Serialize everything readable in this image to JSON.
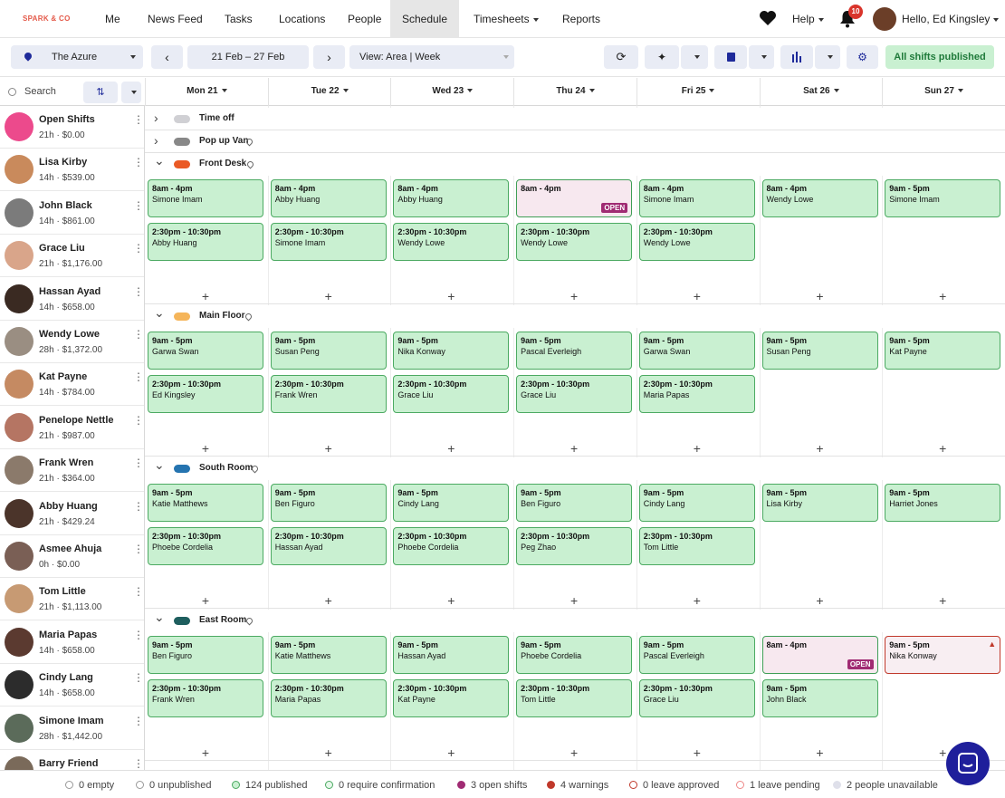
{
  "nav": {
    "logo": "SPARK & CO",
    "items": [
      "Me",
      "News Feed",
      "Tasks",
      "Locations",
      "People",
      "Schedule",
      "Timesheets",
      "Reports"
    ],
    "help": "Help",
    "notif_count": "10",
    "user_greeting": "Hello, Ed Kingsley"
  },
  "toolbar": {
    "location": "The Azure",
    "date_range": "21 Feb – 27 Feb",
    "view": "View: Area | Week",
    "publish_status": "All shifts published",
    "search_placeholder": "Search"
  },
  "days": [
    "Mon 21",
    "Tue 22",
    "Wed 23",
    "Thu 24",
    "Fri 25",
    "Sat 26",
    "Sun 27"
  ],
  "employees": [
    {
      "name": "Open Shifts",
      "stats": "21h · $0.00",
      "color": "#ec4a8c"
    },
    {
      "name": "Lisa Kirby",
      "stats": "14h · $539.00",
      "color": "#c98a5c"
    },
    {
      "name": "John Black",
      "stats": "14h · $861.00",
      "color": "#7b7b7b"
    },
    {
      "name": "Grace Liu",
      "stats": "21h · $1,176.00",
      "color": "#d9a58a"
    },
    {
      "name": "Hassan Ayad",
      "stats": "14h · $658.00",
      "color": "#3a2a22"
    },
    {
      "name": "Wendy Lowe",
      "stats": "28h · $1,372.00",
      "color": "#9a8e82"
    },
    {
      "name": "Kat Payne",
      "stats": "14h · $784.00",
      "color": "#c58a62"
    },
    {
      "name": "Penelope Nettle",
      "stats": "21h · $987.00",
      "color": "#b57563"
    },
    {
      "name": "Frank Wren",
      "stats": "21h · $364.00",
      "color": "#8b7a6b"
    },
    {
      "name": "Abby Huang",
      "stats": "21h · $429.24",
      "color": "#4b342a"
    },
    {
      "name": "Asmee Ahuja",
      "stats": "0h · $0.00",
      "color": "#7a5f55"
    },
    {
      "name": "Tom Little",
      "stats": "21h · $1,113.00",
      "color": "#c79a73"
    },
    {
      "name": "Maria Papas",
      "stats": "14h · $658.00",
      "color": "#5b3a30"
    },
    {
      "name": "Cindy Lang",
      "stats": "14h · $658.00",
      "color": "#2c2c2c"
    },
    {
      "name": "Simone Imam",
      "stats": "28h · $1,442.00",
      "color": "#5b6b5a"
    },
    {
      "name": "Barry Friend",
      "stats": "",
      "color": "#7a6a5a"
    }
  ],
  "collapsed_areas": [
    {
      "name": "Time off",
      "color": "#d0d0d4"
    },
    {
      "name": "Pop up Van",
      "color": "#888888"
    }
  ],
  "areas": [
    {
      "name": "Front Desk",
      "color": "#ea5a25",
      "rows": [
        [
          {
            "t": "8am - 4pm",
            "n": "Simone Imam"
          },
          {
            "t": "8am - 4pm",
            "n": "Abby Huang"
          },
          {
            "t": "8am - 4pm",
            "n": "Abby Huang"
          },
          {
            "t": "8am - 4pm",
            "n": "",
            "open": true
          },
          {
            "t": "8am - 4pm",
            "n": "Simone Imam"
          },
          {
            "t": "8am - 4pm",
            "n": "Wendy Lowe"
          },
          {
            "t": "9am - 5pm",
            "n": "Simone Imam"
          }
        ],
        [
          {
            "t": "2:30pm - 10:30pm",
            "n": "Abby Huang"
          },
          {
            "t": "2:30pm - 10:30pm",
            "n": "Simone Imam"
          },
          {
            "t": "2:30pm - 10:30pm",
            "n": "Wendy Lowe"
          },
          {
            "t": "2:30pm - 10:30pm",
            "n": "Wendy Lowe"
          },
          {
            "t": "2:30pm - 10:30pm",
            "n": "Wendy Lowe"
          },
          null,
          null
        ]
      ]
    },
    {
      "name": "Main Floor",
      "color": "#f5b55a",
      "rows": [
        [
          {
            "t": "9am - 5pm",
            "n": "Garwa Swan"
          },
          {
            "t": "9am - 5pm",
            "n": "Susan Peng"
          },
          {
            "t": "9am - 5pm",
            "n": "Nika Konway"
          },
          {
            "t": "9am - 5pm",
            "n": "Pascal Everleigh"
          },
          {
            "t": "9am - 5pm",
            "n": "Garwa Swan"
          },
          {
            "t": "9am - 5pm",
            "n": "Susan Peng"
          },
          {
            "t": "9am - 5pm",
            "n": "Kat Payne"
          }
        ],
        [
          {
            "t": "2:30pm - 10:30pm",
            "n": "Ed Kingsley"
          },
          {
            "t": "2:30pm - 10:30pm",
            "n": "Frank Wren"
          },
          {
            "t": "2:30pm - 10:30pm",
            "n": "Grace Liu"
          },
          {
            "t": "2:30pm - 10:30pm",
            "n": "Grace Liu"
          },
          {
            "t": "2:30pm - 10:30pm",
            "n": "Maria Papas"
          },
          null,
          null
        ]
      ]
    },
    {
      "name": "South Room",
      "color": "#2574b0",
      "rows": [
        [
          {
            "t": "9am - 5pm",
            "n": "Katie Matthews"
          },
          {
            "t": "9am - 5pm",
            "n": "Ben Figuro"
          },
          {
            "t": "9am - 5pm",
            "n": "Cindy Lang"
          },
          {
            "t": "9am - 5pm",
            "n": "Ben Figuro"
          },
          {
            "t": "9am - 5pm",
            "n": "Cindy Lang"
          },
          {
            "t": "9am - 5pm",
            "n": "Lisa Kirby"
          },
          {
            "t": "9am - 5pm",
            "n": "Harriet Jones"
          }
        ],
        [
          {
            "t": "2:30pm - 10:30pm",
            "n": "Phoebe Cordelia"
          },
          {
            "t": "2:30pm - 10:30pm",
            "n": "Hassan Ayad"
          },
          {
            "t": "2:30pm - 10:30pm",
            "n": "Phoebe Cordelia"
          },
          {
            "t": "2:30pm - 10:30pm",
            "n": "Peg Zhao"
          },
          {
            "t": "2:30pm - 10:30pm",
            "n": "Tom Little"
          },
          null,
          null
        ]
      ]
    },
    {
      "name": "East Room",
      "color": "#1e5e5e",
      "rows": [
        [
          {
            "t": "9am - 5pm",
            "n": "Ben Figuro"
          },
          {
            "t": "9am - 5pm",
            "n": "Katie Matthews"
          },
          {
            "t": "9am - 5pm",
            "n": "Hassan Ayad"
          },
          {
            "t": "9am - 5pm",
            "n": "Phoebe Cordelia"
          },
          {
            "t": "9am - 5pm",
            "n": "Pascal Everleigh"
          },
          {
            "t": "8am - 4pm",
            "n": "",
            "open": true
          },
          {
            "t": "9am - 5pm",
            "n": "Nika Konway",
            "warn": true
          }
        ],
        [
          {
            "t": "2:30pm - 10:30pm",
            "n": "Frank Wren"
          },
          {
            "t": "2:30pm - 10:30pm",
            "n": "Maria Papas"
          },
          {
            "t": "2:30pm - 10:30pm",
            "n": "Kat Payne"
          },
          {
            "t": "2:30pm - 10:30pm",
            "n": "Tom Little"
          },
          {
            "t": "2:30pm - 10:30pm",
            "n": "Grace Liu"
          },
          {
            "t": "9am - 5pm",
            "n": "John Black"
          },
          null
        ]
      ]
    }
  ],
  "open_badge": "OPEN",
  "legend": [
    {
      "label": "0 empty",
      "color": "#ffffff",
      "border": "#999999"
    },
    {
      "label": "0 unpublished",
      "color": "#ffffff",
      "border": "#999999"
    },
    {
      "label": "124 published",
      "color": "#c9f0d1",
      "border": "#4caa62"
    },
    {
      "label": "0 require confirmation",
      "color": "#e6f7ea",
      "border": "#4caa62"
    },
    {
      "label": "3 open shifts",
      "color": "#a02b73",
      "border": "#a02b73"
    },
    {
      "label": "4 warnings",
      "color": "#c0392b",
      "border": "#c0392b"
    },
    {
      "label": "0 leave approved",
      "color": "#ffffff",
      "border": "#c0392b"
    },
    {
      "label": "1 leave pending",
      "color": "#ffffff",
      "border": "#e88"
    },
    {
      "label": "2 people unavailable",
      "color": "#dfe0ea",
      "border": "#dfe0ea"
    }
  ]
}
